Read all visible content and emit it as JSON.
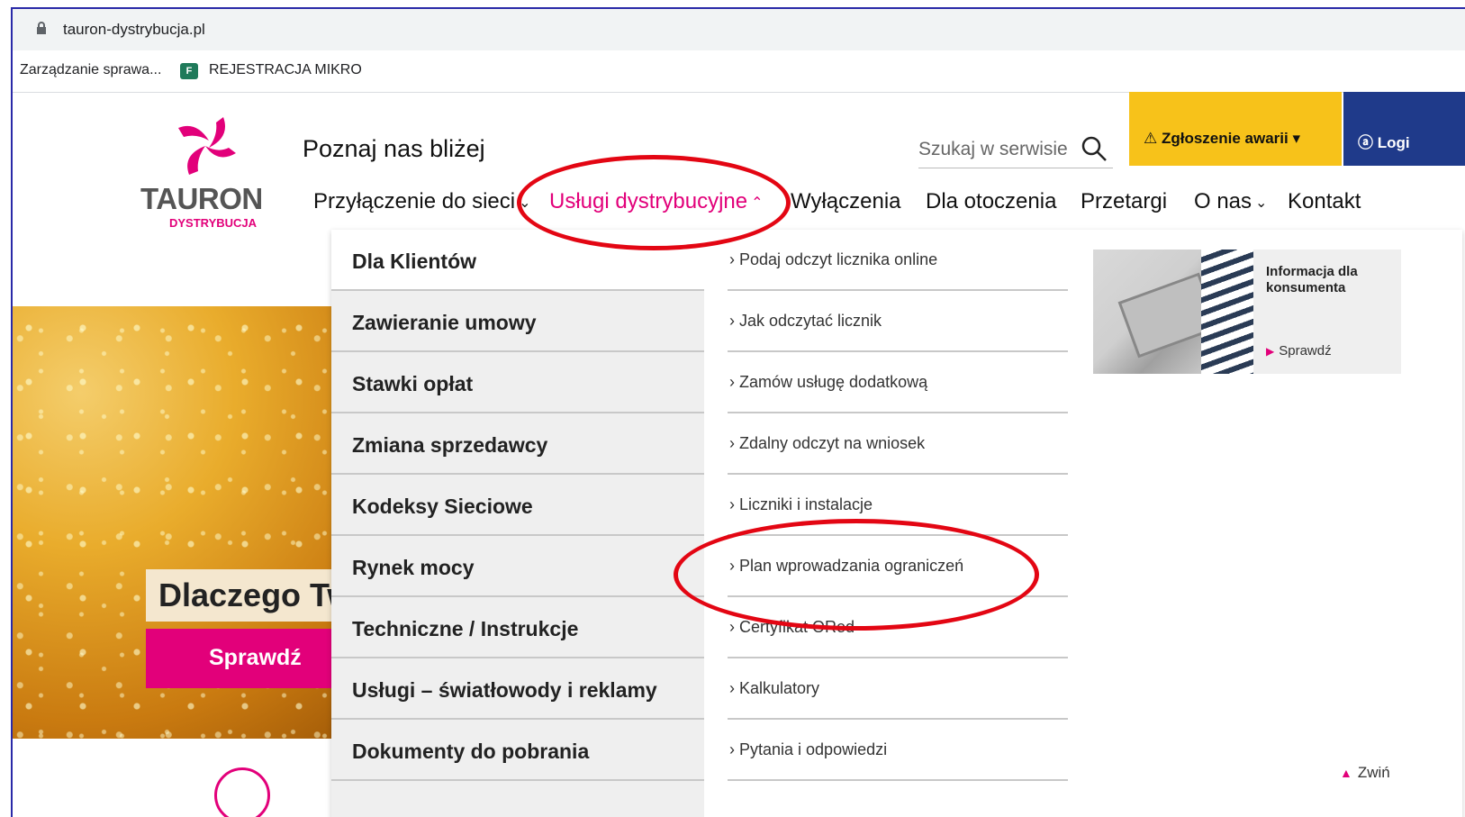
{
  "browser": {
    "url": "tauron-dystrybucja.pl",
    "bookmarks": [
      "Zarządzanie sprawa...",
      "REJESTRACJA MIKRO"
    ],
    "bookmark_icon_text": "F"
  },
  "header": {
    "logo_word": "TAURON",
    "logo_sub": "DYSTRYBUCJA",
    "title": "Poznaj nas bliżej",
    "search_placeholder": "Szukaj w serwisie",
    "awaria": "⚠ Zgłoszenie awarii ▾",
    "login": "ⓐ Logi",
    "nav": [
      "Przyłączenie do sieci",
      "Usługi dystrybucyjne",
      "Wyłączenia",
      "Dla otoczenia",
      "Przetargi",
      "O nas",
      "Kontakt"
    ],
    "accent": "#e2007a"
  },
  "hero": {
    "caption": "Dlaczego Tw",
    "button": "Sprawdź"
  },
  "menu": {
    "left": [
      "Dla Klientów",
      "Zawieranie umowy",
      "Stawki opłat",
      "Zmiana sprzedawcy",
      "Kodeksy Sieciowe",
      "Rynek mocy",
      "Techniczne / Instrukcje",
      "Usługi – światłowody i reklamy",
      "Dokumenty do pobrania"
    ],
    "middle": [
      "› Podaj odczyt licznika online",
      "› Jak odczytać licznik",
      "› Zamów usługę dodatkową",
      "› Zdalny odczyt na wniosek",
      "› Liczniki i instalacje",
      "› Plan wprowadzania ograniczeń",
      "› Certyfikat ORed",
      "› Kalkulatory",
      "› Pytania i odpowiedzi"
    ],
    "card": {
      "title": "Informacja dla konsumenta",
      "link": "Sprawdź"
    },
    "collapse": "Zwiń"
  },
  "annotation_color": "#e30613"
}
